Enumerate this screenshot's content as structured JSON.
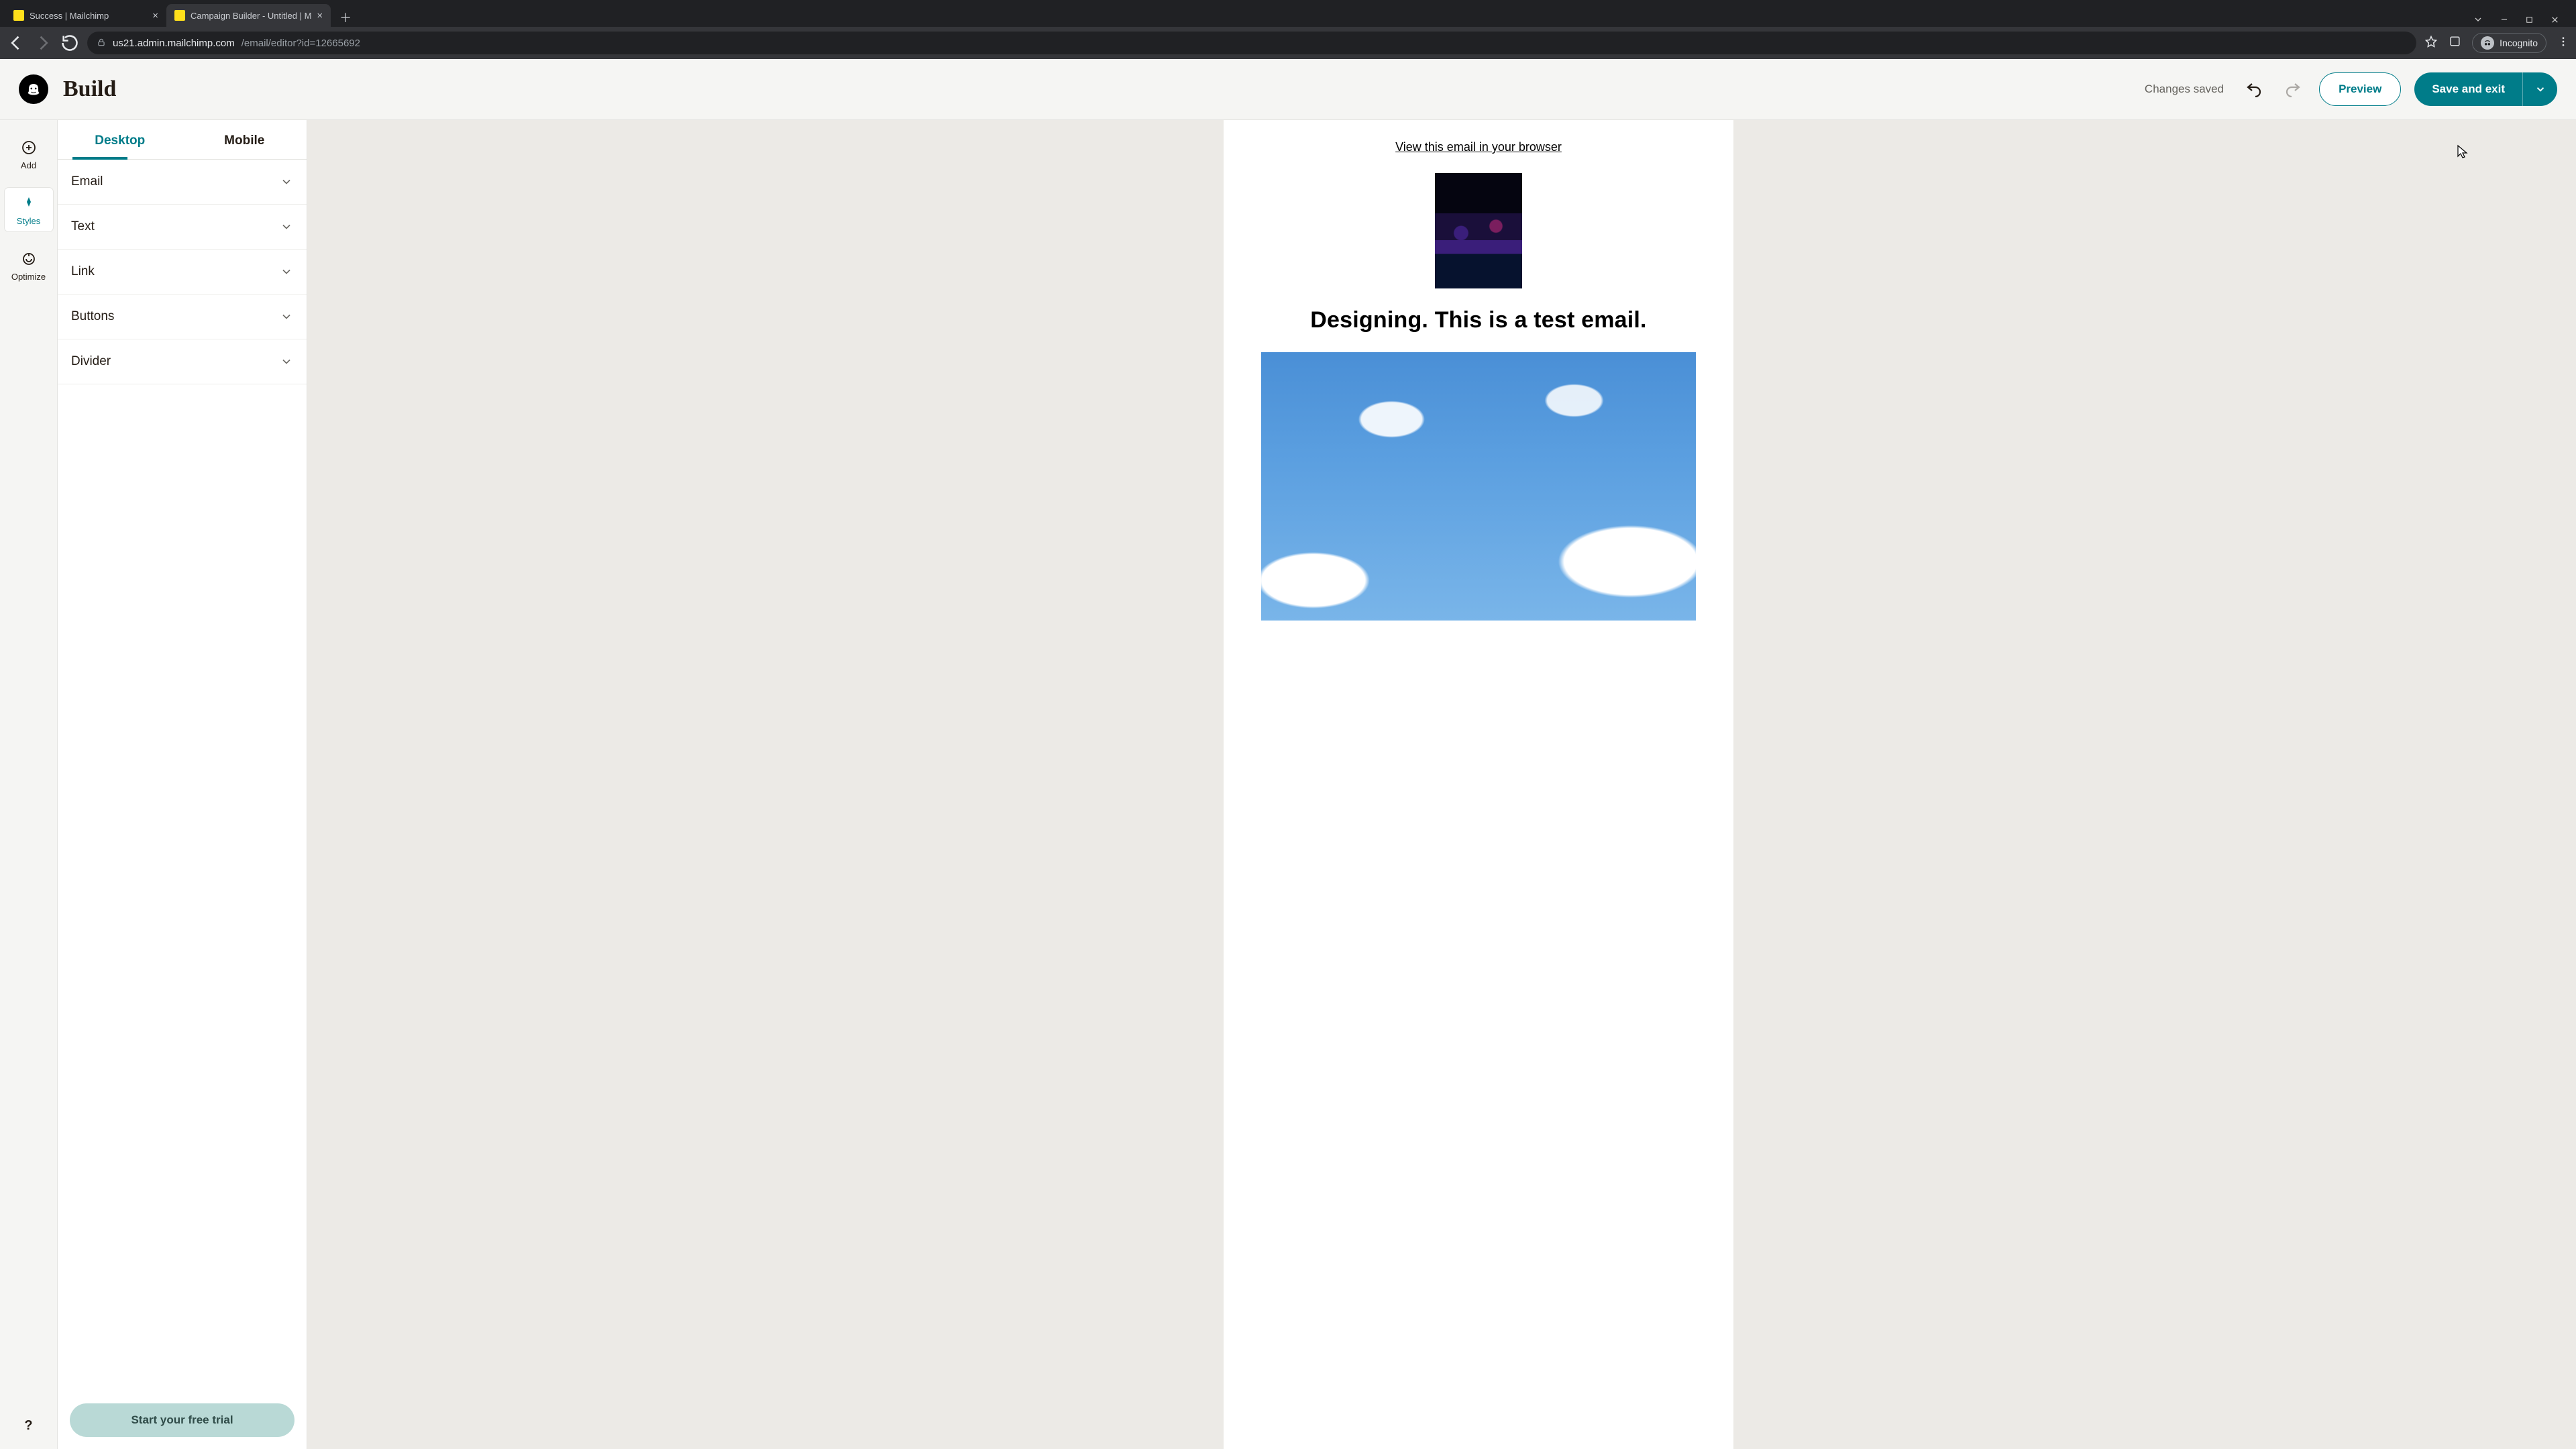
{
  "browser": {
    "tabs": [
      {
        "title": "Success | Mailchimp",
        "active": false
      },
      {
        "title": "Campaign Builder - Untitled | M",
        "active": true
      }
    ],
    "url_host": "us21.admin.mailchimp.com",
    "url_path": "/email/editor?id=12665692",
    "incognito_label": "Incognito"
  },
  "appbar": {
    "title": "Build",
    "status": "Changes saved",
    "preview": "Preview",
    "save": "Save and exit"
  },
  "rail": {
    "items": [
      {
        "key": "add",
        "label": "Add"
      },
      {
        "key": "styles",
        "label": "Styles"
      },
      {
        "key": "optimize",
        "label": "Optimize"
      }
    ],
    "active": "styles",
    "help": "?"
  },
  "panel": {
    "tabs": {
      "desktop": "Desktop",
      "mobile": "Mobile",
      "active": "desktop"
    },
    "sections": [
      "Email",
      "Text",
      "Link",
      "Buttons",
      "Divider"
    ],
    "cta": "Start your free trial"
  },
  "email_preview": {
    "view_in_browser": "View this email in your browser",
    "headline": "Designing. This is a test email."
  },
  "colors": {
    "teal": "#007c89",
    "teal_muted": "#b9d9d6",
    "page_bg": "#f5f5f3",
    "canvas_bg": "#eceae6"
  }
}
